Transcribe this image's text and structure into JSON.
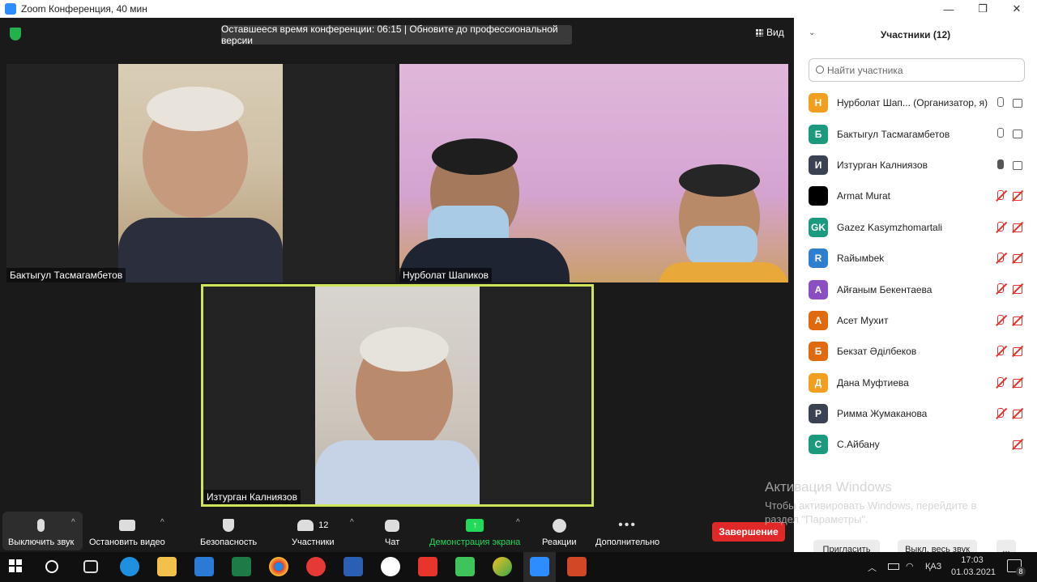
{
  "window": {
    "title": "Zoom Конференция, 40 мин",
    "controls": [
      "—",
      "❐",
      "✕"
    ]
  },
  "meeting": {
    "banner": "Оставшееся время конференции: 06:15 | Обновите до профессиональной версии",
    "view_label": "Вид",
    "tiles": [
      {
        "name": "Бактыгул Тасмагамбетов"
      },
      {
        "name": "Нурболат Шапиков"
      },
      {
        "name": "Изтурган Калниязов"
      }
    ]
  },
  "toolbar": {
    "mute_label": "Выключить звук",
    "video_label": "Остановить видео",
    "security_label": "Безопасность",
    "participants_label": "Участники",
    "participants_count": "12",
    "chat_label": "Чат",
    "share_label": "Демонстрация экрана",
    "reactions_label": "Реакции",
    "more_label": "Дополнительно",
    "end_label": "Завершение",
    "caret": "^",
    "accent_green": "#23d95a",
    "end_color": "#e02828"
  },
  "sidebar": {
    "title": "Участники (12)",
    "search_placeholder": "Найти участника",
    "participants": [
      {
        "initial": "Н",
        "name": "Нурболат Шап... (Организатор, я)",
        "color": "#f0a01e",
        "mic": "on",
        "cam": "on"
      },
      {
        "initial": "Б",
        "name": "Бактыгул Тасмагамбетов",
        "color": "#1c9a7e",
        "mic": "on",
        "cam": "on"
      },
      {
        "initial": "И",
        "name": "Изтурган Калниязов",
        "color": "#3a4253",
        "mic": "speaking",
        "cam": "on"
      },
      {
        "initial": "",
        "name": "Armat Murat",
        "color": "#000000",
        "mic": "muted",
        "cam": "off"
      },
      {
        "initial": "GK",
        "name": "Gazez Kasymzhomartali",
        "color": "#1c9a7e",
        "mic": "muted",
        "cam": "off"
      },
      {
        "initial": "R",
        "name": "Raйымbek",
        "color": "#2f7fd0",
        "mic": "muted",
        "cam": "off"
      },
      {
        "initial": "А",
        "name": "Айғаным Бекентаева",
        "color": "#8a4fc0",
        "mic": "muted",
        "cam": "off"
      },
      {
        "initial": "А",
        "name": "Асет Мухит",
        "color": "#e06a0e",
        "mic": "muted",
        "cam": "off"
      },
      {
        "initial": "Б",
        "name": "Бекзат Әділбеков",
        "color": "#e06a0e",
        "mic": "muted",
        "cam": "off"
      },
      {
        "initial": "Д",
        "name": "Дана Муфтиева",
        "color": "#f0a01e",
        "mic": "muted",
        "cam": "off"
      },
      {
        "initial": "Р",
        "name": "Римма Жумаканова",
        "color": "#3a4253",
        "mic": "muted",
        "cam": "off"
      },
      {
        "initial": "С",
        "name": "С.Айбану",
        "color": "#1c9a7e",
        "mic": "none",
        "cam": "off"
      }
    ],
    "invite_label": "Пригласить",
    "mute_all_label": "Выкл. весь звук",
    "more_label": "..."
  },
  "watermark": {
    "title": "Активация Windows",
    "subtitle": "Чтобы активировать Windows, перейдите в раздел \"Параметры\"."
  },
  "taskbar": {
    "language": "ҚАЗ",
    "time": "17:03",
    "date": "01.03.2021",
    "notifications": "8",
    "apps": [
      "start",
      "search",
      "task-view",
      "edge",
      "explorer",
      "mail",
      "excel",
      "chrome",
      "opera",
      "word",
      "yandex-browser",
      "yandex",
      "android",
      "paint",
      "zoom",
      "powerpoint"
    ]
  }
}
